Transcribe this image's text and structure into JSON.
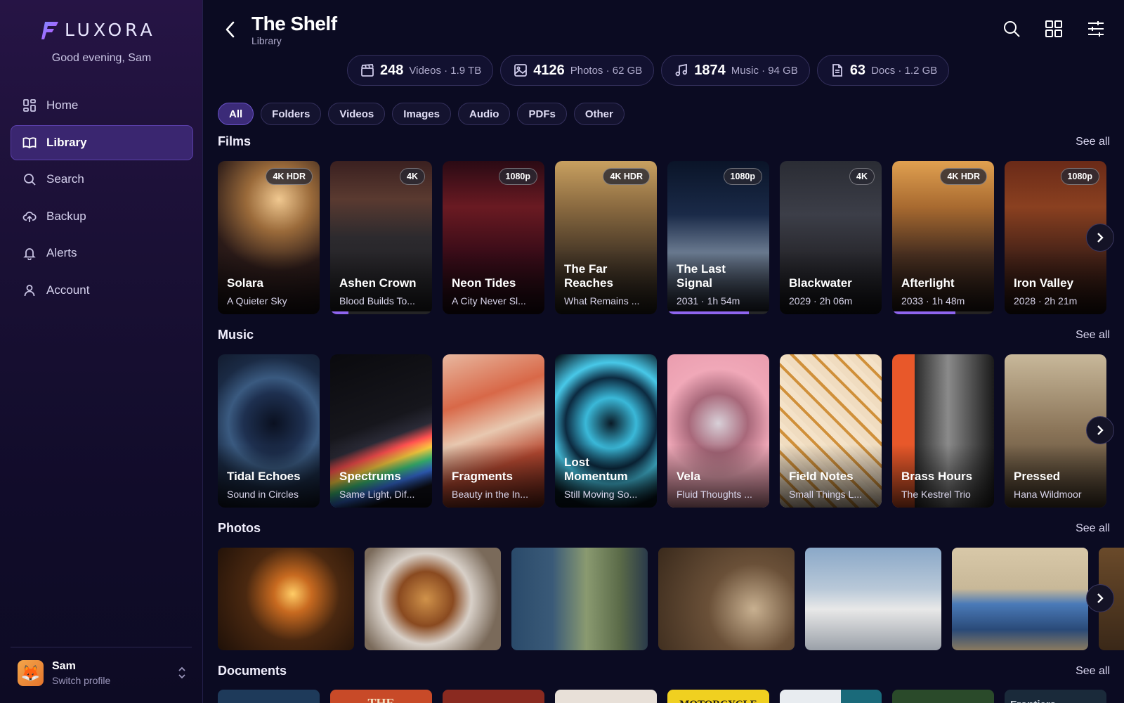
{
  "app": {
    "brand": "LUXORA",
    "greeting": "Good evening, Sam"
  },
  "nav": [
    {
      "label": "Home",
      "icon": "dashboard-icon"
    },
    {
      "label": "Library",
      "icon": "book-icon",
      "active": true
    },
    {
      "label": "Search",
      "icon": "search-icon"
    },
    {
      "label": "Backup",
      "icon": "cloud-upload-icon"
    },
    {
      "label": "Alerts",
      "icon": "bell-icon"
    },
    {
      "label": "Account",
      "icon": "user-icon"
    }
  ],
  "profile": {
    "name": "Sam",
    "action": "Switch profile"
  },
  "header": {
    "title": "The Shelf",
    "subtitle": "Library"
  },
  "stats": [
    {
      "count": "248",
      "label": "Videos · 1.9 TB",
      "icon": "clapperboard-icon"
    },
    {
      "count": "4126",
      "label": "Photos · 62 GB",
      "icon": "image-icon"
    },
    {
      "count": "1874",
      "label": "Music · 94 GB",
      "icon": "music-note-icon"
    },
    {
      "count": "63",
      "label": "Docs · 1.2 GB",
      "icon": "document-icon"
    }
  ],
  "filters": [
    "All",
    "Folders",
    "Videos",
    "Images",
    "Audio",
    "PDFs",
    "Other"
  ],
  "see_all": "See all",
  "sections": {
    "films": {
      "title": "Films",
      "items": [
        {
          "title": "Solara",
          "subtitle": "A Quieter Sky",
          "badge": "4K HDR",
          "progress": 0
        },
        {
          "title": "Ashen Crown",
          "subtitle": "Blood Builds To...",
          "badge": "4K",
          "progress": 0.18
        },
        {
          "title": "Neon Tides",
          "subtitle": "A City Never Sl...",
          "badge": "1080p",
          "progress": 0
        },
        {
          "title": "The Far Reaches",
          "subtitle": "What Remains ...",
          "badge": "4K HDR",
          "progress": 0
        },
        {
          "title": "The Last Signal",
          "subtitle": "2031 · 1h 54m",
          "badge": "1080p",
          "progress": 0.8
        },
        {
          "title": "Blackwater",
          "subtitle": "2029 · 2h 06m",
          "badge": "4K",
          "progress": 0
        },
        {
          "title": "Afterlight",
          "subtitle": "2033 · 1h 48m",
          "badge": "4K HDR",
          "progress": 0.62
        },
        {
          "title": "Iron Valley",
          "subtitle": "2028 · 2h 21m",
          "badge": "1080p",
          "progress": 0
        }
      ]
    },
    "music": {
      "title": "Music",
      "items": [
        {
          "title": "Tidal Echoes",
          "subtitle": "Sound in Circles"
        },
        {
          "title": "Spectrums",
          "subtitle": "Same Light, Dif..."
        },
        {
          "title": "Fragments",
          "subtitle": "Beauty in the In..."
        },
        {
          "title": "Lost Momentum",
          "subtitle": "Still Moving So..."
        },
        {
          "title": "Vela",
          "subtitle": "Fluid Thoughts ..."
        },
        {
          "title": "Field Notes",
          "subtitle": "Small Things L..."
        },
        {
          "title": "Brass Hours",
          "subtitle": "The Kestrel Trio"
        },
        {
          "title": "Pressed",
          "subtitle": "Hana Wildmoor"
        }
      ]
    },
    "photos": {
      "title": "Photos"
    },
    "documents": {
      "title": "Documents",
      "items": [
        "THE",
        "",
        "",
        "",
        "MOTORCYCLE",
        "",
        "",
        "Frontiers"
      ]
    }
  },
  "colors": {
    "accent": "#8f65f0",
    "background": "#0b0b22",
    "active_nav": "#3a2670"
  }
}
